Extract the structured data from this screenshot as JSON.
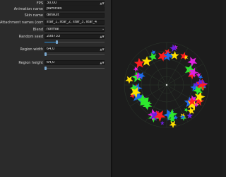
{
  "properties": {
    "fps": {
      "label": "FPS",
      "value": "30,00"
    },
    "animation_name": {
      "label": "Animation name",
      "value": "particles"
    },
    "skin_name": {
      "label": "Skin name",
      "value": "default"
    },
    "attachment_names": {
      "label": "Attachment names (comma)",
      "value": "star_1, star_2, star_3, star_4"
    },
    "blend": {
      "label": "Blend",
      "value": "normal"
    },
    "random_seed": {
      "label": "Random seed",
      "value": "208733",
      "slider_fraction": 0.2
    },
    "region_width": {
      "label": "Region width",
      "value": "64,0",
      "slider_fraction": 0.0
    },
    "region_height": {
      "label": "Region height",
      "value": "64,0",
      "slider_fraction": 0.0
    }
  },
  "icons": {
    "spinner": "up-down-arrows",
    "dropdown": "chevron-down-icon"
  },
  "colors": {
    "panel_bg": "#2b2b2b",
    "field_bg": "#1d1d1d",
    "accent": "#2f8fd6",
    "viewport_bg": "#1c1c1c",
    "star_colors": [
      "#ffe000",
      "#2ee82e",
      "#ff2020",
      "#6c1fe0",
      "#e020e0",
      "#1c6cf0"
    ]
  }
}
